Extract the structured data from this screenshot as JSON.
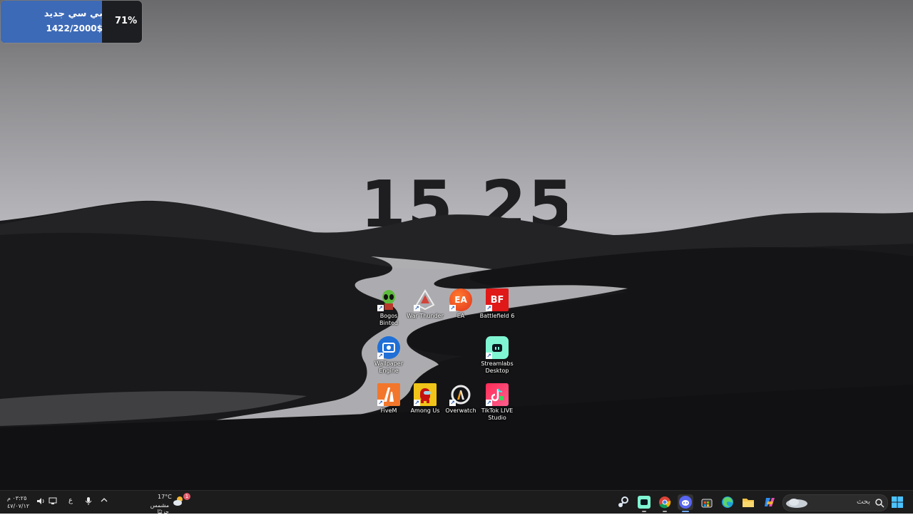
{
  "budget_widget": {
    "title": "بي سي جديد",
    "amount": "1422/2000$",
    "percent_label": "71%",
    "progress": 0.71,
    "fill_color": "#3d6ab7"
  },
  "desktop_clock": "15.25",
  "desktop_icons": [
    {
      "label": "Bogos Binted",
      "icon": "alien-icon"
    },
    {
      "label": "War Thunder",
      "icon": "war-thunder-icon"
    },
    {
      "label": "EA",
      "icon": "ea-icon"
    },
    {
      "label": "Battlefield 6",
      "icon": "battlefield-icon"
    },
    {
      "label": "Wallpaper Engine",
      "icon": "wallpaper-engine-icon"
    },
    {
      "label": "Streamlabs Desktop",
      "icon": "streamlabs-icon"
    },
    {
      "label": "FiveM",
      "icon": "fivem-icon"
    },
    {
      "label": "Among Us",
      "icon": "among-us-icon"
    },
    {
      "label": "Overwatch",
      "icon": "overwatch-icon"
    },
    {
      "label": "TikTok LIVE Studio",
      "icon": "tiktok-live-icon"
    }
  ],
  "taskbar": {
    "search_placeholder": "بحث",
    "weather_temp": "17°C",
    "weather_desc": "مشمس جزئيًا",
    "weather_badge": "1",
    "time": "٠٣:٢٥ م",
    "date": "٤٧/٠٧/١٢",
    "keyboard_lang": "ع",
    "apps": [
      "start-icon",
      "search-icon",
      "copilot-icon",
      "file-explorer-icon",
      "edge-icon",
      "microsoft-store-icon",
      "discord-icon",
      "chrome-icon",
      "streamlabs-icon",
      "steam-icon"
    ]
  }
}
